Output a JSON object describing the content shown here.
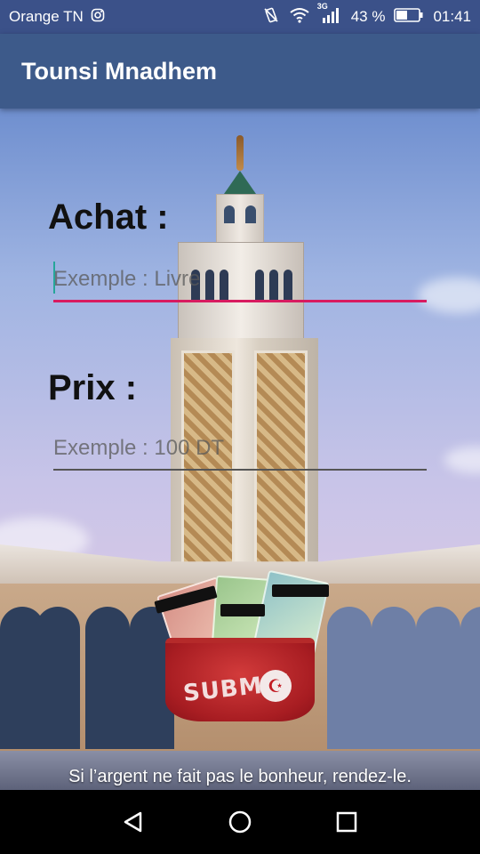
{
  "status_bar": {
    "carrier": "Orange TN",
    "network": "3G",
    "battery_percent": "43 %",
    "time": "01:41",
    "icons": [
      "instagram-icon",
      "no-vibrate-icon",
      "wifi-icon",
      "signal-icon",
      "battery-icon"
    ]
  },
  "app_bar": {
    "title": "Tounsi Mnadhem",
    "color": "#3d5a8a"
  },
  "form": {
    "purchase_label": "Achat :",
    "purchase_placeholder": "Exemple : Livre",
    "purchase_value": "",
    "price_label": "Prix :",
    "price_placeholder": "Exemple : 100 DT",
    "price_value": "",
    "accent_color": "#d81b60"
  },
  "submit": {
    "label": "SUBMIT"
  },
  "quote": "Si l’argent ne fait pas le bonheur, rendez-le.",
  "nav_bar": {
    "icons": [
      "back-icon",
      "home-icon",
      "recents-icon"
    ]
  }
}
